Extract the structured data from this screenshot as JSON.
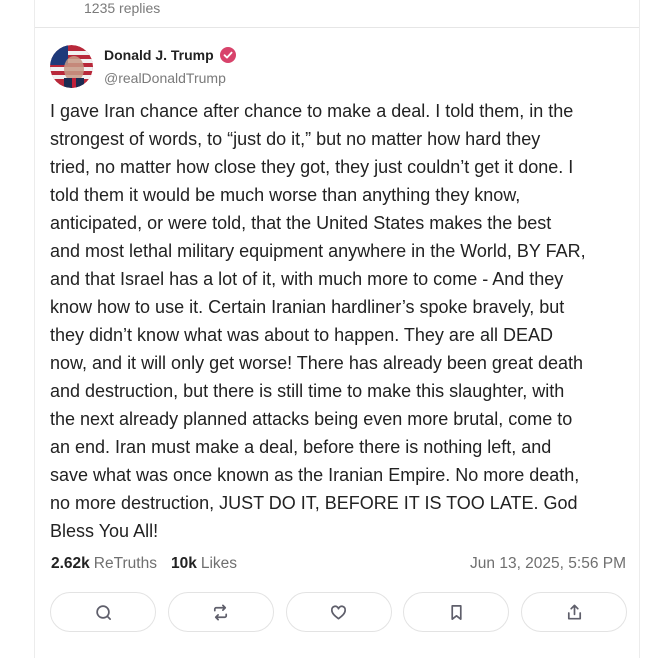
{
  "thread": {
    "replies_label": "1235 replies"
  },
  "post": {
    "author_name": "Donald J. Trump",
    "handle": "@realDonaldTrump",
    "text": "I gave Iran chance after chance to make a deal. I told them, in the\nstrongest of words, to “just do it,” but no matter how hard they\ntried, no matter how close they got, they just couldn’t get it done. I\ntold them it would be much worse than anything they know,\nanticipated, or were told, that the United States makes the best\nand most lethal military equipment anywhere in the World, BY FAR,\nand that Israel has a lot of it, with much more to come - And they\nknow how to use it. Certain Iranian hardliner’s spoke bravely, but\nthey didn’t know what was about to happen. They are all DEAD\nnow, and it will only get worse! There has already been great death\nand destruction, but there is still time to make this slaughter, with\nthe next already planned attacks being even more brutal, come to\nan end. Iran must make a deal, before there is nothing left, and\nsave what was once known as the Iranian Empire. No more death,\nno more destruction, JUST DO IT, BEFORE IT IS TOO LATE. God\nBless You All!",
    "retruths_count": "2.62k",
    "retruths_label": "ReTruths",
    "likes_count": "10k",
    "likes_label": "Likes",
    "timestamp": "Jun 13, 2025, 5:56 PM"
  },
  "actions": [
    "reply-icon",
    "retruth-icon",
    "like-icon",
    "bookmark-icon",
    "share-icon"
  ],
  "colors": {
    "verified_badge": "#d8436b",
    "icon_gray": "#5f5f6b",
    "border": "#e3e3e3"
  }
}
